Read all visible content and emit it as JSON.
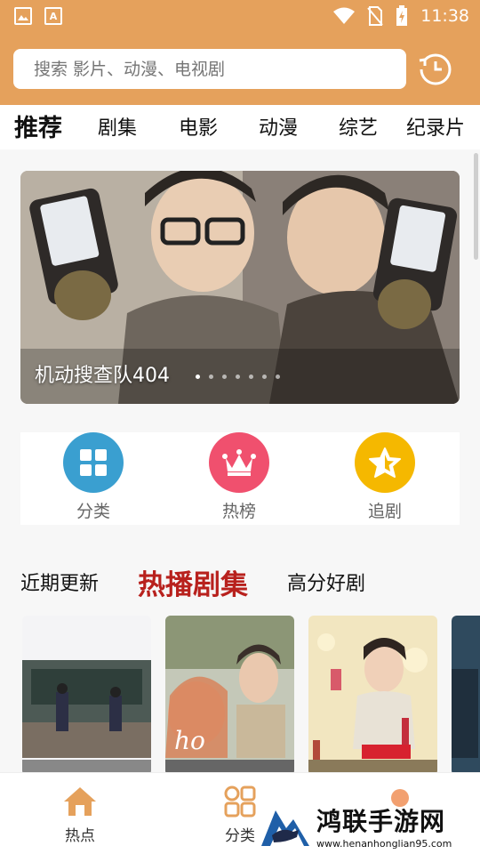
{
  "status_bar": {
    "time": "11:38"
  },
  "search": {
    "placeholder": "搜索 影片、动漫、电视剧"
  },
  "tabs": [
    {
      "label": "推荐",
      "active": true
    },
    {
      "label": "剧集"
    },
    {
      "label": "电影"
    },
    {
      "label": "动漫"
    },
    {
      "label": "综艺"
    },
    {
      "label": "纪录片"
    }
  ],
  "banner": {
    "title": "机动搜查队404",
    "dot_count": 7,
    "active_dot": 0
  },
  "quick_links": [
    {
      "label": "分类",
      "icon": "grid-icon",
      "color": "#3a9fd0"
    },
    {
      "label": "热榜",
      "icon": "crown-icon",
      "color": "#f0506e"
    },
    {
      "label": "追剧",
      "icon": "star-icon",
      "color": "#f5b800"
    }
  ],
  "section_tabs": [
    {
      "label": "近期更新"
    },
    {
      "label": "热播剧集",
      "active": true
    },
    {
      "label": "高分好剧"
    }
  ],
  "bottom_nav": [
    {
      "label": "热点",
      "icon": "home-icon",
      "active": true
    },
    {
      "label": "分类",
      "icon": "category-icon"
    }
  ],
  "watermark": {
    "title": "鸿联手游网",
    "url": "www.henanhonglian95.com"
  },
  "colors": {
    "brand": "#e5a15c",
    "accent_red": "#b8211d"
  }
}
